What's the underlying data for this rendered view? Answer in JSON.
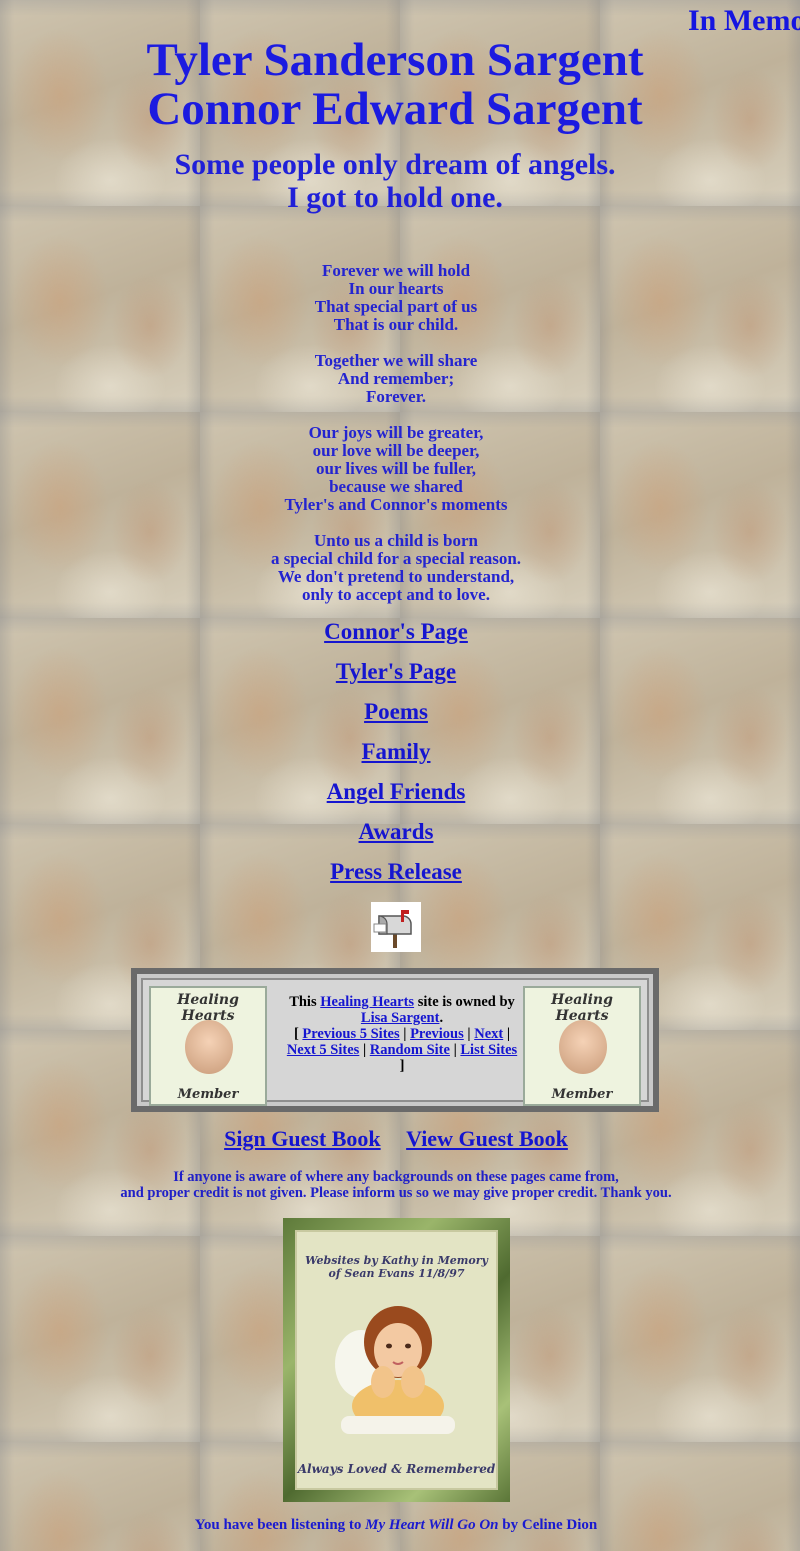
{
  "marquee": {
    "text": "In Memory"
  },
  "header": {
    "name1": "Tyler Sanderson Sargent",
    "name2": "Connor Edward Sargent",
    "motto1": "Some people only dream of angels.",
    "motto2": "I got to hold one."
  },
  "poem": {
    "stanzas": [
      [
        "Forever we will hold",
        "In our hearts",
        "That special part of us",
        "That is our child."
      ],
      [
        "Together we will share",
        "And remember;",
        "Forever."
      ],
      [
        "Our joys will be greater,",
        "our love will be deeper,",
        "our lives will be fuller,",
        "because we shared",
        "Tyler's and Connor's moments"
      ],
      [
        "Unto us a child is born",
        "a special child for a special reason.",
        "We don't pretend to understand,",
        "only to accept and to love."
      ]
    ]
  },
  "nav": {
    "links": [
      "Connor's Page",
      "Tyler's Page",
      "Poems",
      "Family",
      "Angel Friends",
      "Awards",
      "Press Release"
    ]
  },
  "webring": {
    "badge_top": "Healing Hearts",
    "badge_bottom": "Member",
    "text_this": "This",
    "ring_name": "Healing Hearts",
    "text_owned": "site is owned by",
    "owner": "Lisa Sargent",
    "period": ".",
    "open_bracket": "[",
    "close_bracket": "]",
    "sep": "|",
    "prev5": "Previous 5 Sites",
    "prev": "Previous",
    "next": "Next",
    "next5": "Next 5 Sites",
    "random": "Random Site",
    "list": "List Sites"
  },
  "guestbook": {
    "sign": "Sign Guest Book",
    "view": "View Guest Book"
  },
  "credit": {
    "line1": "If anyone is aware of where any backgrounds on these pages came from,",
    "line2": "and proper credit is not given. Please inform us so we may give proper credit. Thank you."
  },
  "card": {
    "top1": "Websites by Kathy in Memory",
    "top2": "of Sean Evans 11/8/97",
    "bottom": "Always Loved & Remembered"
  },
  "music": {
    "prefix": "You have been listening to",
    "song": "My Heart Will Go On",
    "by": "by Celine Dion"
  }
}
